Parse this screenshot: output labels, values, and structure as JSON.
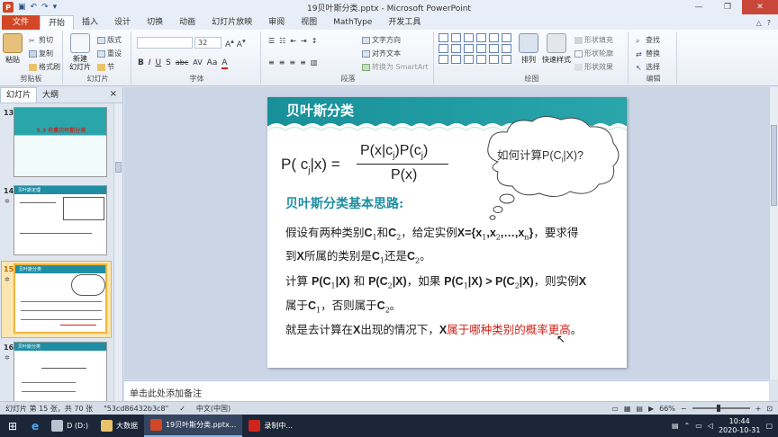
{
  "window": {
    "title": "19贝叶斯分类.pptx - Microsoft PowerPoint"
  },
  "ribbon": {
    "tabs": [
      "开始",
      "插入",
      "设计",
      "切换",
      "动画",
      "幻灯片放映",
      "审阅",
      "视图",
      "MathType",
      "开发工具"
    ],
    "file_tab": "文件",
    "groups": {
      "clipboard": {
        "label": "剪贴板",
        "paste": "粘贴",
        "cut": "剪切",
        "copy": "复制",
        "format_painter": "格式刷"
      },
      "slides": {
        "label": "幻灯片",
        "new_slide": "新建\n幻灯片",
        "layout": "版式",
        "reset": "重设",
        "section": "节"
      },
      "font": {
        "label": "字体",
        "size": "32",
        "buttons": [
          "B",
          "I",
          "U",
          "S",
          "abc",
          "AV",
          "Aa",
          "A"
        ]
      },
      "paragraph": {
        "label": "段落",
        "text_direction": "文字方向",
        "align_text": "对齐文本",
        "smartart": "转换为 SmartArt"
      },
      "drawing": {
        "label": "绘图",
        "arrange": "排列",
        "quick_styles": "快速样式",
        "shape_fill": "形状填充",
        "shape_outline": "形状轮廓",
        "shape_effects": "形状效果"
      },
      "editing": {
        "label": "编辑",
        "find": "查找",
        "replace": "替换",
        "select": "选择"
      }
    }
  },
  "left_panel": {
    "tabs": [
      "幻灯片",
      "大纲"
    ],
    "close": "×",
    "thumbnails": [
      {
        "number": "13",
        "title": "5.3 朴素贝叶斯分类"
      },
      {
        "number": "14",
        "title": "贝叶斯定理"
      },
      {
        "number": "15",
        "title": "贝叶斯分类"
      },
      {
        "number": "16",
        "title": "贝叶斯分类"
      }
    ]
  },
  "slide": {
    "title": "贝叶斯分类",
    "formula": {
      "lhs": "P( c",
      "lhs_sub": "j",
      "lhs_end": "|x) =",
      "numerator": "P(x|c",
      "numerator_sub": "j",
      "numerator_mid": ")P(c",
      "numerator_sub2": "j",
      "numerator_end": ")",
      "denominator": "P(x)"
    },
    "thought_bubble": {
      "text": "如何计算P(C",
      "sub": "i",
      "text_end": "|X)?"
    },
    "subheading": "贝叶斯分类基本思路:",
    "lines": {
      "l1": {
        "a": "假设有两种类别",
        "c1": "C",
        "s1": "1",
        "and": "和",
        "c2": "C",
        "s2": "2",
        "b": "，给定实例",
        "x": "X={x",
        "xs1": "1",
        "xc": ",x",
        "xs2": "2",
        "xd": ",…,x",
        "xsn": "n",
        "xe": "}",
        "c": "，要求得"
      },
      "l2": {
        "a": "到",
        "x": "X",
        "b": "所属的类别是",
        "c1": "C",
        "s1": "1",
        "c": "还是",
        "c2": "C",
        "s2": "2",
        "d": "。"
      },
      "l3": {
        "a": "计算 ",
        "p1": "P(C",
        "s1": "1",
        "p1e": "|X)",
        "b": " 和 ",
        "p2": "P(C",
        "s2": "2",
        "p2e": "|X)",
        "c": "，如果 ",
        "p3": "P(C",
        "s3": "1",
        "p3e": "|X) > P(C",
        "s4": "2",
        "p4e": "|X)",
        "d": "，则实例",
        "x": "X"
      },
      "l4": {
        "a": "属于",
        "c1": "C",
        "s1": "1",
        "b": "，否则属于",
        "c2": "C",
        "s2": "2",
        "c": "。"
      },
      "l5": {
        "a": "就是去计算在",
        "x": "X",
        "b": "出现的情况下，",
        "x2": "X",
        "red": "属于哪种类别的概率更高",
        "c": "。"
      }
    }
  },
  "notes": {
    "placeholder": "单击此处添加备注"
  },
  "status_bar": {
    "slide_info": "幻灯片 第 15 张，共 70 张",
    "theme": "\"53cd86432b3c8\"",
    "language": "中文(中国)",
    "zoom": "66%"
  },
  "taskbar": {
    "items": [
      {
        "label": "D (D:)"
      },
      {
        "label": "大数据"
      },
      {
        "label": "19贝叶斯分类.pptx..."
      },
      {
        "label": "录制中..."
      }
    ],
    "time": "10:44",
    "date": "2020-10-31"
  },
  "colors": {
    "accent_teal": "#1e8ea2",
    "file_tab": "#d24726",
    "highlight_red": "#d0231a"
  }
}
